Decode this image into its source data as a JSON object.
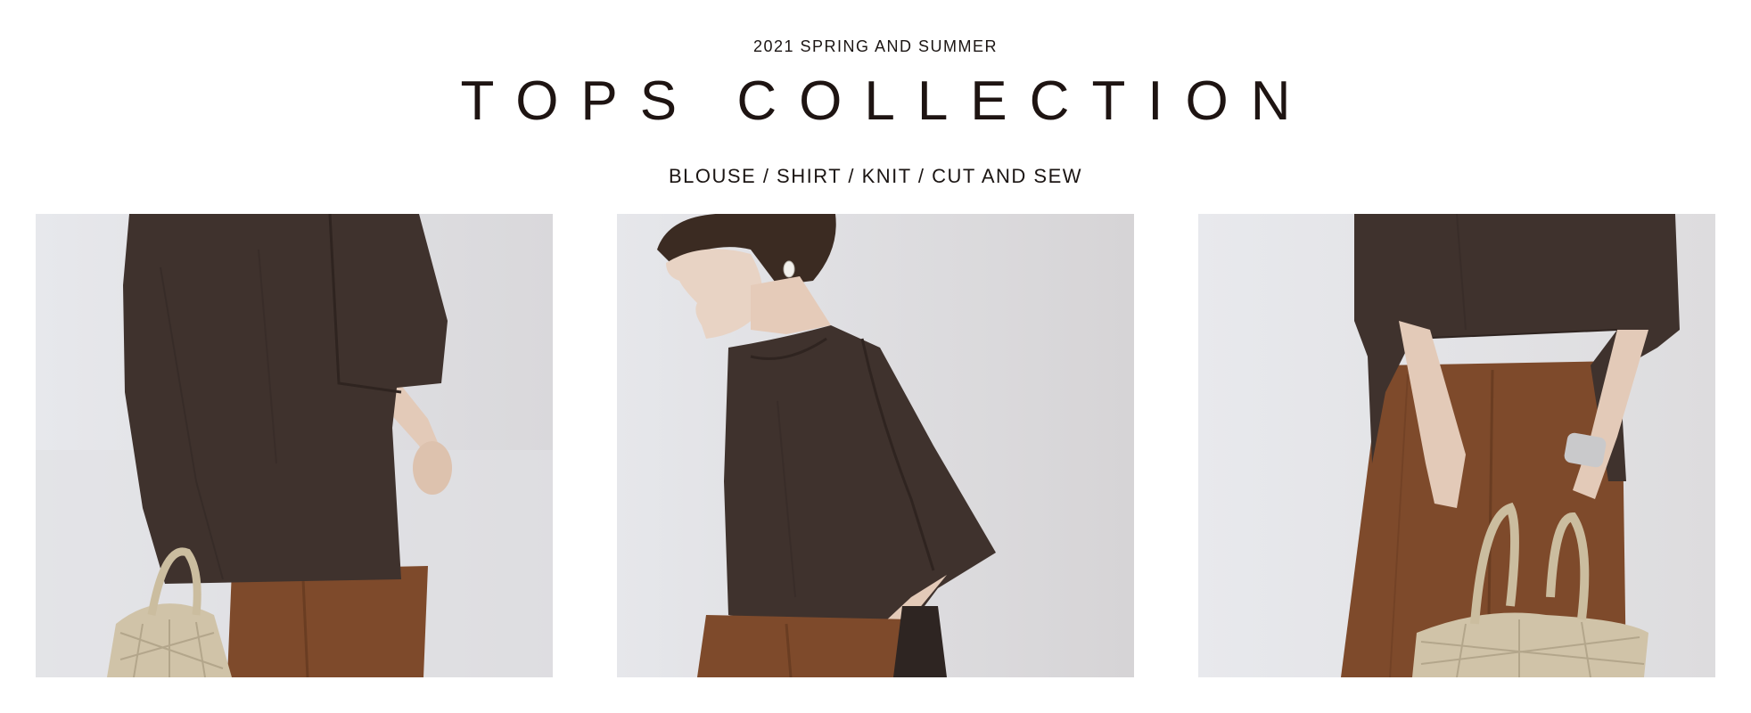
{
  "header": {
    "season": "2021 SPRING AND SUMMER",
    "title": "TOPS COLLECTION",
    "categories": "BLOUSE / SHIRT / KNIT / CUT AND SEW"
  },
  "gallery": {
    "photos": [
      {
        "subject": "back view, dark brown blouse, rust trousers, woven bag"
      },
      {
        "subject": "side view, dark brown blouse, model looking down"
      },
      {
        "subject": "front crop, dark brown blouse, rust trousers, woven bag"
      }
    ]
  },
  "colors": {
    "background": "#ffffff",
    "text": "#1e1412",
    "blouse": "#3f322d",
    "trousers": "#7e4a2b",
    "bag": "#d0c3a8",
    "skin": "#e8d3c4",
    "backdrop": "#e4e5e8"
  }
}
